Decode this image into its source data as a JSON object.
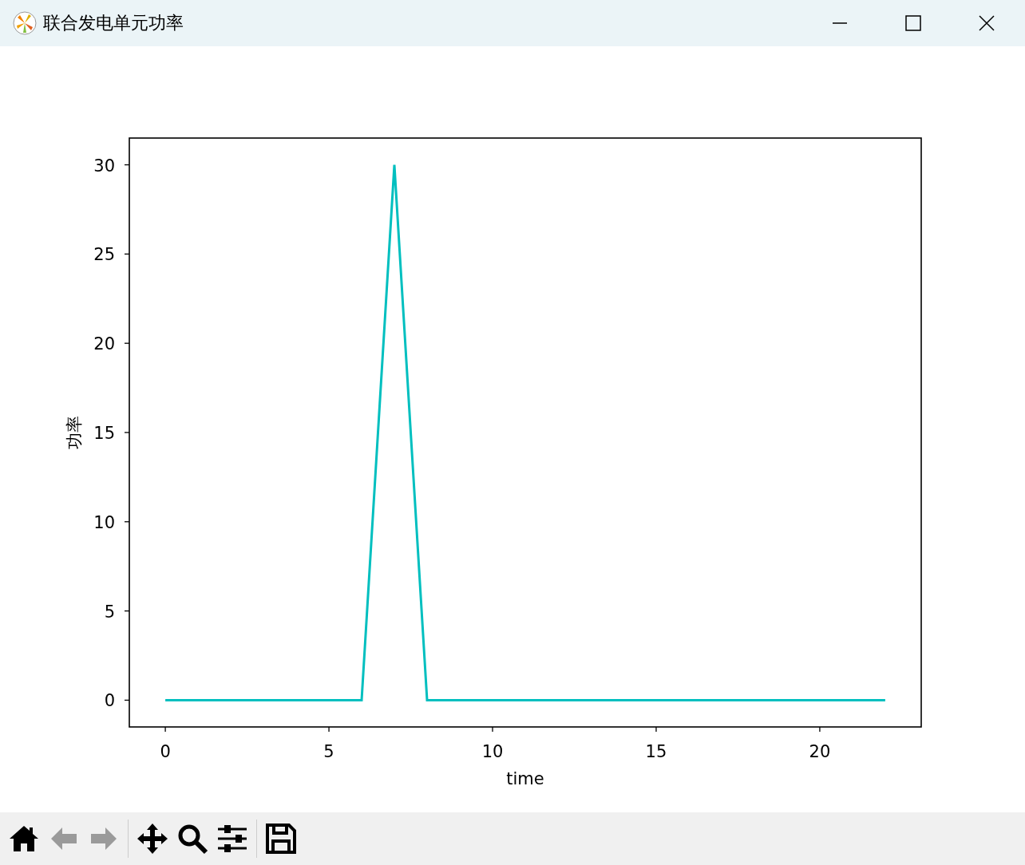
{
  "window": {
    "title": "联合发电单元功率"
  },
  "figure": {
    "chart_data": {
      "type": "line",
      "xlabel": "time",
      "ylabel": "功率",
      "x": [
        0,
        1,
        2,
        3,
        4,
        5,
        6,
        7,
        8,
        9,
        10,
        11,
        12,
        13,
        14,
        15,
        16,
        17,
        18,
        19,
        20,
        21,
        22
      ],
      "series": [
        {
          "color": "#00bfbf",
          "values": [
            0,
            0,
            0,
            0,
            0,
            0,
            0,
            30,
            0,
            0,
            0,
            0,
            0,
            0,
            0,
            0,
            0,
            0,
            0,
            0,
            0,
            0,
            0
          ]
        }
      ],
      "xlim": [
        -1.1,
        23.1
      ],
      "ylim": [
        -1.5,
        31.5
      ],
      "xticks": [
        0,
        5,
        10,
        15,
        20
      ],
      "yticks": [
        0,
        5,
        10,
        15,
        20,
        25,
        30
      ]
    }
  },
  "toolbar": {
    "tools": [
      {
        "kind": "home",
        "disabled": false
      },
      {
        "kind": "back",
        "disabled": true
      },
      {
        "kind": "forward",
        "disabled": true
      },
      {
        "kind": "separator"
      },
      {
        "kind": "pan",
        "disabled": false
      },
      {
        "kind": "zoom",
        "disabled": false
      },
      {
        "kind": "configure",
        "disabled": false
      },
      {
        "kind": "separator"
      },
      {
        "kind": "save",
        "disabled": false
      }
    ]
  }
}
